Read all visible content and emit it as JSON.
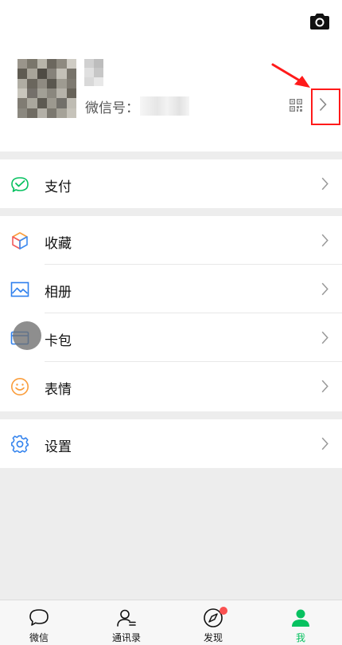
{
  "profile": {
    "wechat_id_label": "微信号：",
    "avatar_tiles": [
      "#9a958b",
      "#7a766b",
      "#b8b5aa",
      "#6b675e",
      "#8e8a80",
      "#cfccc4",
      "#5f5b52",
      "#a8a499",
      "#4f4b44",
      "#86827a",
      "#c3c0b7",
      "#77736a",
      "#b0ada3",
      "#6a665d",
      "#8f8b82",
      "#5a574f",
      "#9e9b91",
      "#7e7a71",
      "#c9c6bd",
      "#74706a",
      "#a2a096",
      "#8a877e",
      "#b6b3aa",
      "#676359",
      "#807c73",
      "#aaa79d",
      "#5d5a52",
      "#9c998f",
      "#72706a",
      "#bfbcb3",
      "#8b887f",
      "#6f6b62",
      "#b3b0a7",
      "#7b786f",
      "#a5a298",
      "#c6c3ba"
    ],
    "nickname_tiles": [
      "#d0d0d0",
      "#bdbdbd",
      "#e0e0e0",
      "#c7c7c7",
      "#d9d9d9",
      "#e8e8e8"
    ]
  },
  "sections": [
    {
      "items": [
        {
          "id": "pay",
          "label": "支付",
          "icon": "pay-icon"
        }
      ]
    },
    {
      "items": [
        {
          "id": "favorites",
          "label": "收藏",
          "icon": "favorites-cube-icon"
        },
        {
          "id": "album",
          "label": "相册",
          "icon": "album-image-icon"
        },
        {
          "id": "cards",
          "label": "卡包",
          "icon": "card-wallet-icon"
        },
        {
          "id": "stickers",
          "label": "表情",
          "icon": "smiley-face-icon"
        }
      ]
    },
    {
      "items": [
        {
          "id": "settings",
          "label": "设置",
          "icon": "settings-gear-icon"
        }
      ]
    }
  ],
  "tabbar": [
    {
      "id": "chats",
      "label": "微信",
      "icon": "chat-bubble-icon",
      "active": false
    },
    {
      "id": "contacts",
      "label": "通讯录",
      "icon": "contacts-person-icon",
      "active": false
    },
    {
      "id": "discover",
      "label": "发现",
      "icon": "compass-icon",
      "active": false,
      "badge": true
    },
    {
      "id": "me",
      "label": "我",
      "icon": "me-person-icon",
      "active": true
    }
  ],
  "colors": {
    "accent_green": "#07c160",
    "annotation_red": "#ff1a1a",
    "badge_red": "#fa5151"
  }
}
